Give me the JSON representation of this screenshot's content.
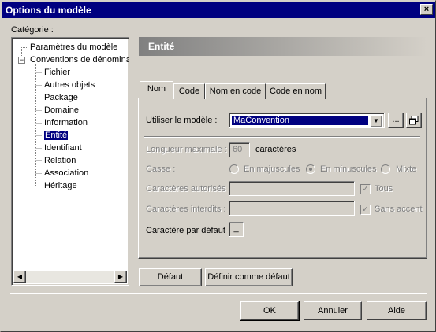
{
  "window": {
    "title": "Options du modèle",
    "close_glyph": "×"
  },
  "category": {
    "label": "Catégorie :",
    "tree": [
      {
        "label": "Paramètres du modèle",
        "level": 0,
        "expander": ""
      },
      {
        "label": "Conventions de dénominat",
        "level": 0,
        "expander": "−"
      },
      {
        "label": "Fichier",
        "level": 1
      },
      {
        "label": "Autres objets",
        "level": 1
      },
      {
        "label": "Package",
        "level": 1
      },
      {
        "label": "Domaine",
        "level": 1
      },
      {
        "label": "Information",
        "level": 1
      },
      {
        "label": "Entité",
        "level": 1,
        "selected": true
      },
      {
        "label": "Identifiant",
        "level": 1
      },
      {
        "label": "Relation",
        "level": 1
      },
      {
        "label": "Association",
        "level": 1
      },
      {
        "label": "Héritage",
        "level": 1
      }
    ],
    "scroll_left_glyph": "◀",
    "scroll_right_glyph": "▶"
  },
  "panel": {
    "header": "Entité",
    "tabs": [
      "Nom",
      "Code",
      "Nom en code",
      "Code en nom"
    ],
    "use_template_label": "Utiliser le modèle :",
    "template_value": "MaConvention",
    "template_dropdown_glyph": "▼",
    "ellipsis_button": "...",
    "max_length_label": "Longueur maximale :",
    "max_length_value": "60",
    "characters_suffix": "caractères",
    "case_label": "Casse :",
    "case_options": [
      "En majuscules",
      "En minuscules",
      "Mixte"
    ],
    "case_selected": "En minuscules",
    "allowed_label": "Caractères autorisés :",
    "allowed_value": "",
    "allowed_all_label": "Tous",
    "allowed_all_checked": true,
    "forbidden_label": "Caractères interdits :",
    "forbidden_value": "",
    "no_accent_label": "Sans accent",
    "no_accent_checked": true,
    "default_char_label": "Caractère par défaut :",
    "default_char_value": "_",
    "check_glyph": "✓"
  },
  "buttons": {
    "default": "Défaut",
    "set_default": "Définir comme défaut",
    "ok": "OK",
    "cancel": "Annuler",
    "help": "Aide"
  }
}
